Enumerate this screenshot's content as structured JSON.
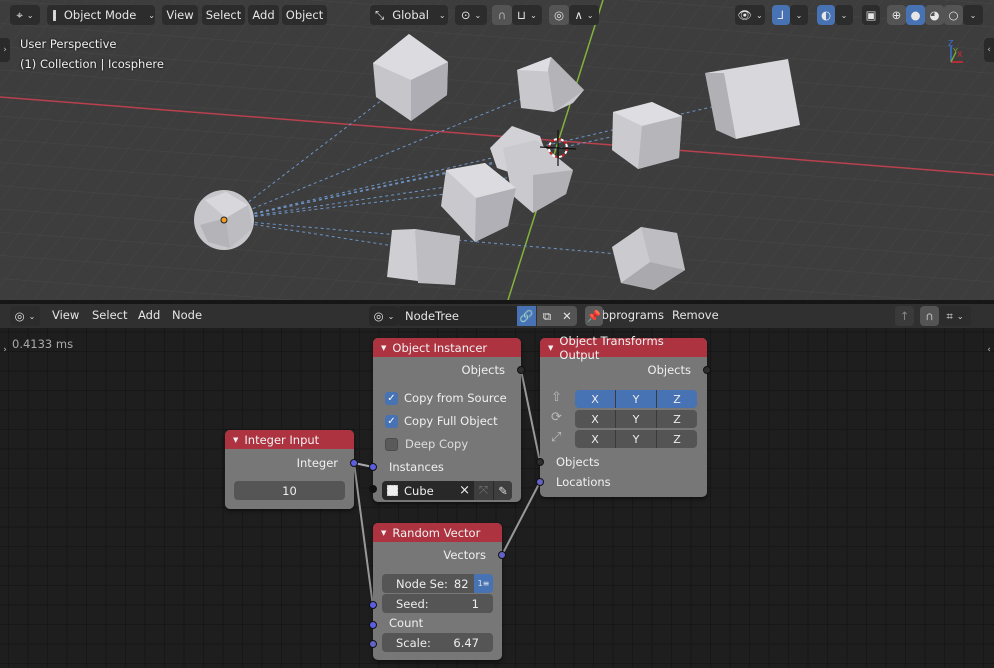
{
  "viewport": {
    "editor_type_icon": "3d-viewport-icon",
    "mode": "Object Mode",
    "menus": [
      "View",
      "Select",
      "Add",
      "Object"
    ],
    "transform_orientation": "Global",
    "overlay_lines": [
      "User Perspective",
      "(1) Collection | Icosphere"
    ],
    "axes": {
      "x": "X",
      "y": "Y",
      "z": "Z"
    },
    "colors": {
      "x_axis": "#b9404d",
      "y_axis": "#83b33a",
      "active_blue": "#4772b3"
    }
  },
  "node_editor": {
    "menus": [
      "View",
      "Select",
      "Add",
      "Node"
    ],
    "tree_name": "NodeTree",
    "subprograms_label": "Subprograms",
    "remove_label": "Remove",
    "timing": "0.4133 ms",
    "nodes": {
      "object_instancer": {
        "title": "Object Instancer",
        "output": "Objects",
        "options": [
          {
            "label": "Copy from Source",
            "checked": true
          },
          {
            "label": "Copy Full Object",
            "checked": true
          },
          {
            "label": "Deep Copy",
            "checked": false
          }
        ],
        "input": "Instances",
        "object_value": "Cube",
        "clear": "×"
      },
      "object_transforms_output": {
        "title": "Object Transforms Output",
        "output": "Objects",
        "rows": [
          {
            "icon": "location-icon",
            "axes": [
              "X",
              "Y",
              "Z"
            ],
            "active": true
          },
          {
            "icon": "rotation-icon",
            "axes": [
              "X",
              "Y",
              "Z"
            ],
            "active": false
          },
          {
            "icon": "scale-icon",
            "axes": [
              "X",
              "Y",
              "Z"
            ],
            "active": false
          }
        ],
        "inputs": [
          "Objects",
          "Locations"
        ]
      },
      "integer_input": {
        "title": "Integer Input",
        "output": "Integer",
        "value": "10"
      },
      "random_vector": {
        "title": "Random Vector",
        "output": "Vectors",
        "node_seed_label": "Node Se:",
        "node_seed_value": "82",
        "seed_label": "Seed:",
        "seed_value": "1",
        "count_label": "Count",
        "scale_label": "Scale:",
        "scale_value": "6.47"
      }
    },
    "colors": {
      "node_header": "#ad3340",
      "node_body": "#777777",
      "socket_int": "#5b5ee0",
      "socket_vector": "#6363c7"
    }
  }
}
